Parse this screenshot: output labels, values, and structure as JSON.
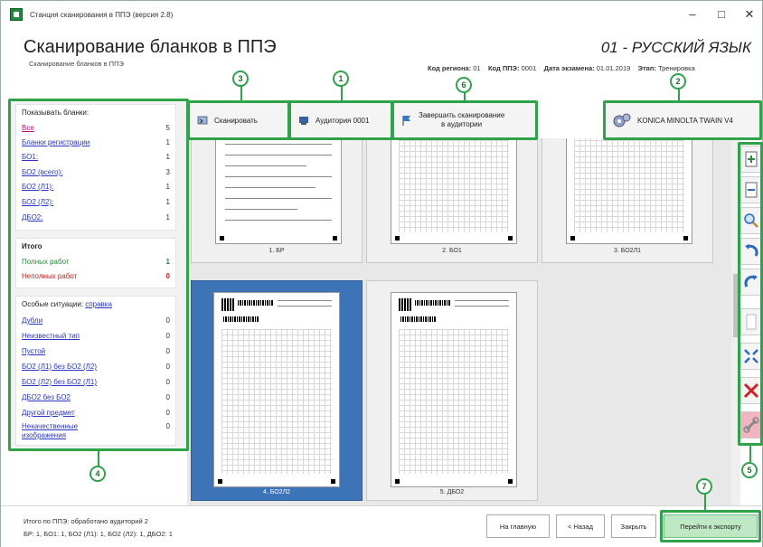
{
  "window": {
    "title": "Станция сканирования в ППЭ (версия 2.8)",
    "minimize": "–",
    "maximize": "□",
    "close": "✕"
  },
  "header": {
    "title": "Сканирование бланков в ППЭ",
    "subtitle": "Сканирование бланков в ППЭ",
    "subject": "01 - РУССКИЙ ЯЗЫК",
    "meta": [
      {
        "label": "Код региона:",
        "value": "01"
      },
      {
        "label": "Код ППЭ:",
        "value": "0001"
      },
      {
        "label": "Дата экзамена:",
        "value": "01.01.2019"
      },
      {
        "label": "Этап:",
        "value": "Тренировка"
      }
    ]
  },
  "toolbar": {
    "scan_label": "Сканировать",
    "auditorium_label": "Аудитория 0001",
    "finish_label_1": "Завершить сканирование",
    "finish_label_2": "в аудитории",
    "scanner_label": "KONICA MINOLTA TWAIN V4"
  },
  "sidebar": {
    "show_title": "Показывать бланки:",
    "filters": [
      {
        "label": "Все",
        "count": "5"
      },
      {
        "label": "Бланки регистрации",
        "count": "1"
      },
      {
        "label": "БО1:",
        "count": "1"
      },
      {
        "label": "БО2 (всего):",
        "count": "3"
      },
      {
        "label": "БО2 (Л1):",
        "count": "1"
      },
      {
        "label": "БО2 (Л2):",
        "count": "1"
      },
      {
        "label": "ДБО2:",
        "count": "1"
      }
    ],
    "totals_title": "Итого",
    "full_label": "Полных работ",
    "full_count": "1",
    "incomplete_label": "Неполных работ",
    "incomplete_count": "0",
    "special_title": "Особые ситуации:",
    "special_link": "справка",
    "special": [
      {
        "label": "Дубли",
        "count": "0"
      },
      {
        "label": "Неизвестный тип",
        "count": "0"
      },
      {
        "label": "Пустой",
        "count": "0"
      },
      {
        "label": "БО2 (Л1) без БО2 (Л2)",
        "count": "0"
      },
      {
        "label": "БО2 (Л2) без БО2 (Л1)",
        "count": "0"
      },
      {
        "label": "ДБО2 без БО2",
        "count": "0"
      },
      {
        "label": "Другой предмет",
        "count": "0"
      },
      {
        "label": "Некачественные изображения",
        "count": "0"
      }
    ]
  },
  "thumbnails": [
    "1. БР",
    "2. БО1",
    "3. БО2Л1",
    "4. БО2Л2",
    "5. ДБО2"
  ],
  "footer": {
    "summary_1": "Итого по ППЭ: обработано аудиторий 2",
    "summary_2": "БР: 1, БО1: 1, БО2 (Л1): 1, БО2 (Л2): 1, ДБО2: 1",
    "home_label": "На главную",
    "back_label": "< Назад",
    "close_label": "Закрыть",
    "export_label": "Перейти к экспорту"
  },
  "annotations": [
    "1",
    "2",
    "3",
    "4",
    "5",
    "6",
    "7"
  ],
  "colors": {
    "annotation": "#2fa34a",
    "selected": "#3d74b8",
    "link": "#2a37c9",
    "error": "#c42121"
  }
}
